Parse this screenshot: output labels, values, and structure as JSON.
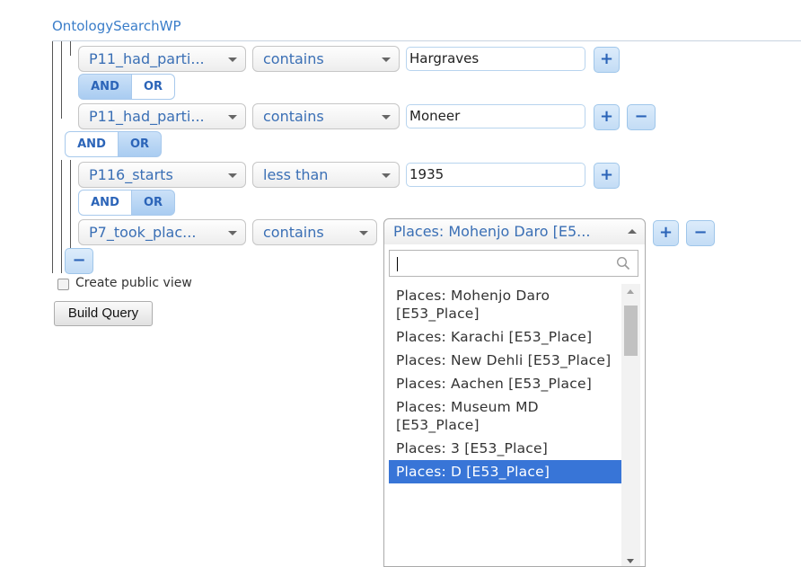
{
  "page": {
    "title": "OntologySearchWP"
  },
  "rows": [
    {
      "property": "P11_had_parti...",
      "operator": "contains",
      "value": "Hargraves"
    },
    {
      "property": "P11_had_parti...",
      "operator": "contains",
      "value": "Moneer"
    },
    {
      "property": "P116_starts",
      "operator": "less than",
      "value": "1935"
    },
    {
      "property": "P7_took_plac...",
      "operator": "contains",
      "value": "Places: Mohenjo Daro [E5..."
    }
  ],
  "logic": [
    {
      "and": "AND",
      "or": "OR",
      "active": "AND"
    },
    {
      "and": "AND",
      "or": "OR",
      "active": "OR"
    },
    {
      "and": "AND",
      "or": "OR",
      "active": "OR"
    }
  ],
  "buttons": {
    "plus": "+",
    "minus": "−"
  },
  "public_view": {
    "label": "Create public view",
    "checked": false
  },
  "build_query": {
    "label": "Build Query"
  },
  "dropdown": {
    "search_value": "",
    "options": [
      "Places: Mohenjo Daro [E53_Place]",
      "Places: Karachi [E53_Place]",
      "Places: New Dehli [E53_Place]",
      "Places: Aachen [E53_Place]",
      "Places: Museum MD [E53_Place]",
      "Places: 3 [E53_Place]",
      "Places: D [E53_Place]"
    ],
    "highlighted_index": 6
  }
}
